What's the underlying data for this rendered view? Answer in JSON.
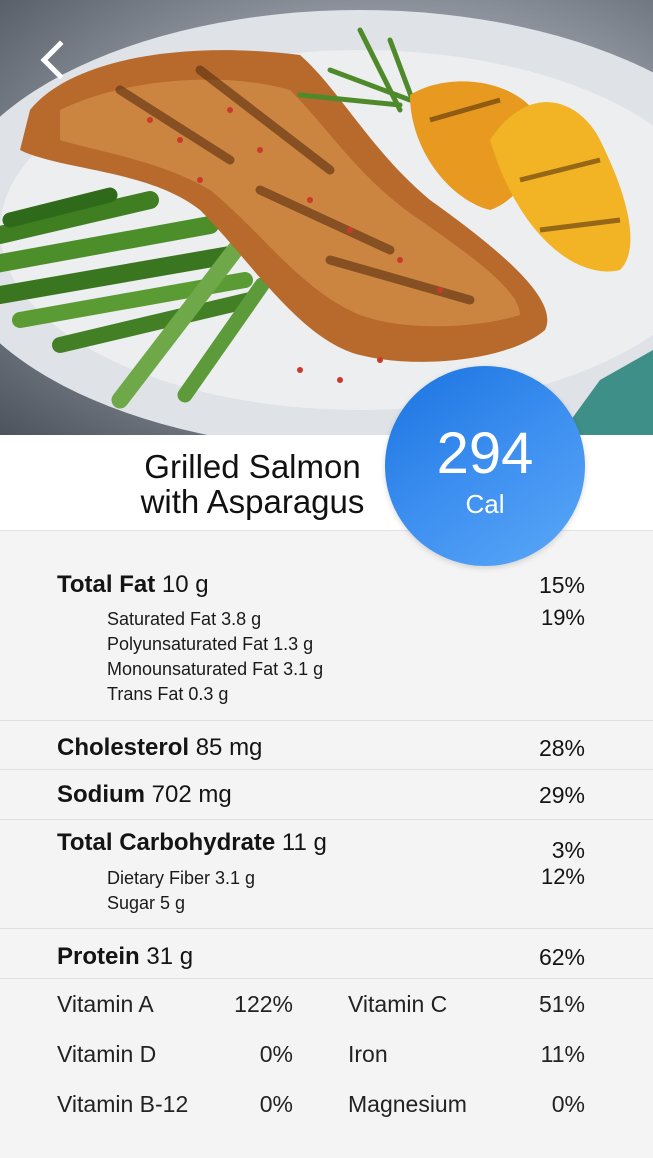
{
  "header": {
    "back_icon": "chevron-left-icon"
  },
  "dish": {
    "title_line1": "Grilled Salmon",
    "title_line2": "with Asparagus"
  },
  "calories": {
    "value": "294",
    "unit": "Cal",
    "badge_color": "#2b83ea"
  },
  "total_fat": {
    "label": "Total Fat",
    "amount": "10 g",
    "pct": "15%",
    "subs": [
      {
        "label": "Saturated Fat 3.8 g",
        "pct": "19%"
      },
      {
        "label": "Polyunsaturated Fat 1.3 g"
      },
      {
        "label": "Monounsaturated Fat 3.1 g"
      },
      {
        "label": "Trans Fat 0.3 g"
      }
    ]
  },
  "cholesterol": {
    "label": "Cholesterol",
    "amount": "85 mg",
    "pct": "28%"
  },
  "sodium": {
    "label": "Sodium",
    "amount": "702 mg",
    "pct": "29%"
  },
  "carbs": {
    "label": "Total Carbohydrate",
    "amount": "11 g",
    "pct": "3%",
    "subs": [
      {
        "label": "Dietary Fiber 3.1 g",
        "pct": "12%"
      },
      {
        "label": "Sugar 5 g"
      }
    ]
  },
  "protein": {
    "label": "Protein",
    "amount": "31 g",
    "pct": "62%"
  },
  "vitamins": [
    {
      "name": "Vitamin A",
      "value": "122%"
    },
    {
      "name": "Vitamin C",
      "value": "51%"
    },
    {
      "name": "Vitamin D",
      "value": "0%"
    },
    {
      "name": "Iron",
      "value": "11%"
    },
    {
      "name": "Vitamin B-12",
      "value": "0%"
    },
    {
      "name": "Magnesium",
      "value": "0%"
    }
  ]
}
